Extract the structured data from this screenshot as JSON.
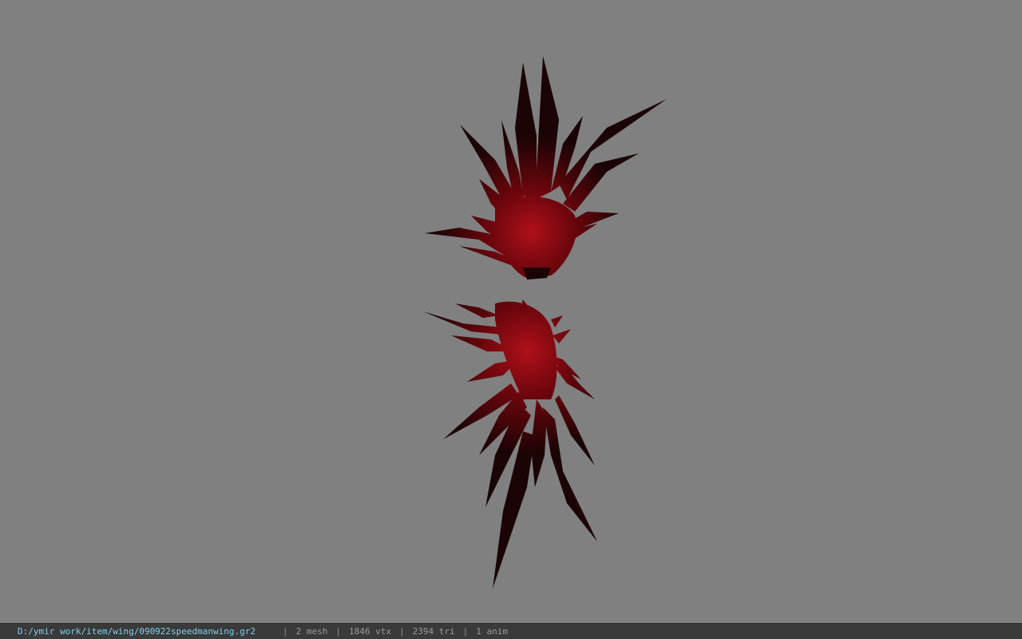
{
  "viewer": {
    "background_color": "#808080",
    "model_colors": {
      "dark": "#1a0405",
      "mid": "#5a070b",
      "highlight": "#b0101a"
    },
    "model_description_icon": "wing-model-icon"
  },
  "status_bar": {
    "file_path": "D:/ymir work/item/wing/090922speedmanwing.gr2",
    "separator": "|",
    "mesh": "2 mesh",
    "vertices": "1846 vtx",
    "triangles": "2394 tri",
    "animations": "1 anim",
    "path_color": "#7fd0ee"
  }
}
